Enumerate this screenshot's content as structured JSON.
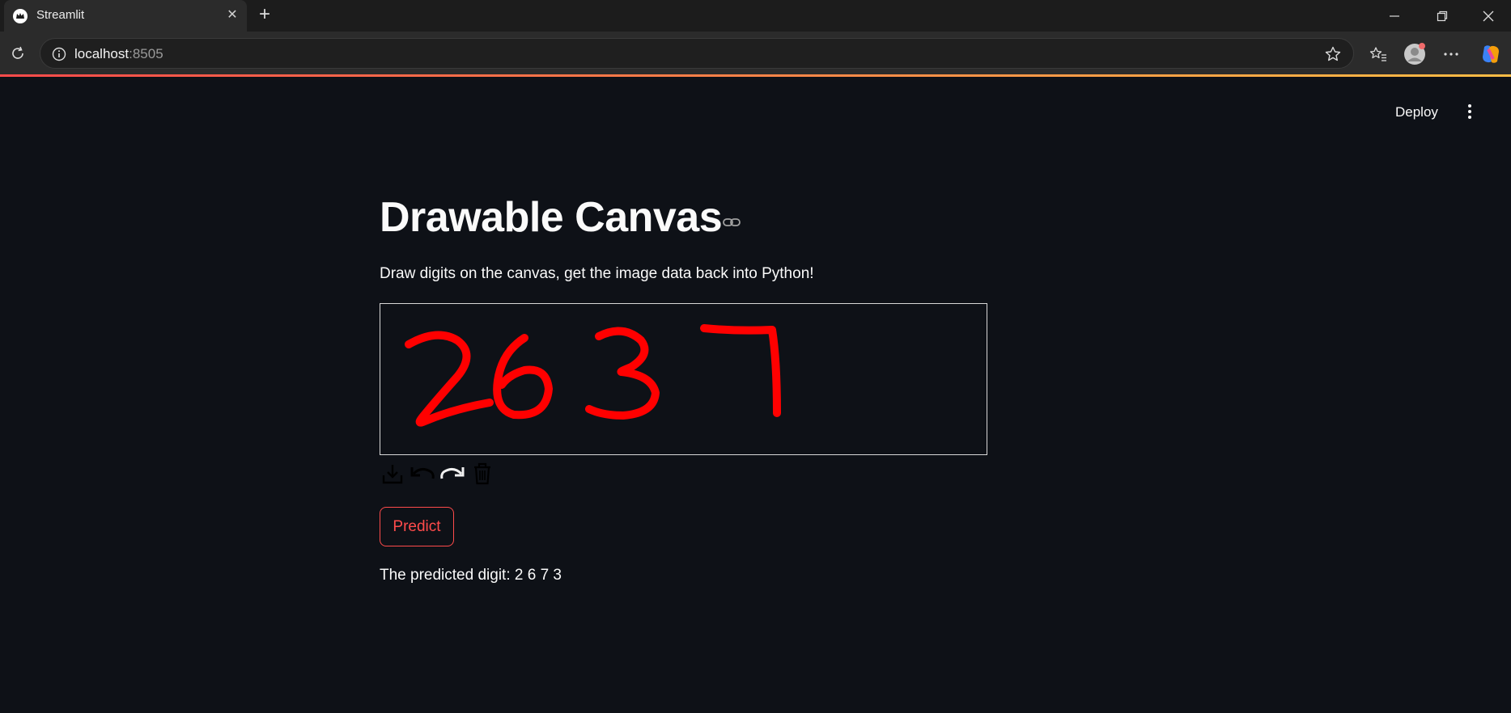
{
  "browser": {
    "tab_title": "Streamlit",
    "url_host": "localhost",
    "url_port": ":8505"
  },
  "app": {
    "deploy_label": "Deploy",
    "title": "Drawable Canvas",
    "description": "Draw digits on the canvas, get the image data back into Python!",
    "canvas": {
      "drawn_digits": "2637",
      "stroke_color": "#ff0000",
      "background_color": "#0e1117"
    },
    "toolbar_icons": [
      "download-icon",
      "undo-icon",
      "redo-icon",
      "trash-icon"
    ],
    "predict_button": "Predict",
    "result_text": "The predicted digit: 2 6 7 3"
  },
  "colors": {
    "accent": "#ff4b4b",
    "app_bg": "#0e1117",
    "text": "#fafafa"
  }
}
